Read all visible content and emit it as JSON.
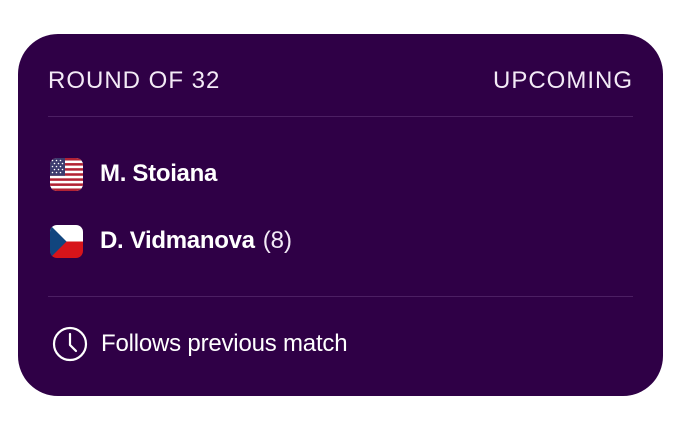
{
  "match": {
    "round": "ROUND OF 32",
    "status": "UPCOMING",
    "players": [
      {
        "name": "M. Stoiana",
        "seed": "",
        "flag": "us-flag-icon"
      },
      {
        "name": "D. Vidmanova",
        "seed": "(8)",
        "flag": "cz-flag-icon"
      }
    ],
    "schedule_note": "Follows previous match",
    "schedule_icon": "clock-icon"
  },
  "colors": {
    "card_bg": "#2f0046",
    "text": "#ffffff",
    "divider": "#4c1f63"
  }
}
